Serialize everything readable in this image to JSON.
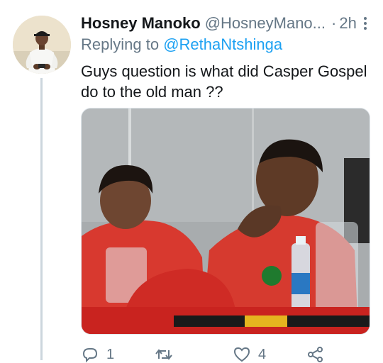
{
  "tweet": {
    "display_name": "Hosney Manoko",
    "handle": "@HosneyMano...",
    "separator": "·",
    "time": "2h",
    "replying_prefix": "Replying to",
    "replying_to": "@RethaNtshinga",
    "text": "Guys question is what did Casper Gospel do to the old man ??",
    "reply_count": "1",
    "retweet_count": "",
    "like_count": "4"
  },
  "colors": {
    "link": "#1da1f2",
    "muted": "#657786",
    "text": "#14171a",
    "thread_line": "#ccd6dd"
  },
  "icons": {
    "more": "more-vertical-icon",
    "reply": "reply-icon",
    "retweet": "retweet-icon",
    "like": "heart-icon",
    "share": "share-icon"
  }
}
